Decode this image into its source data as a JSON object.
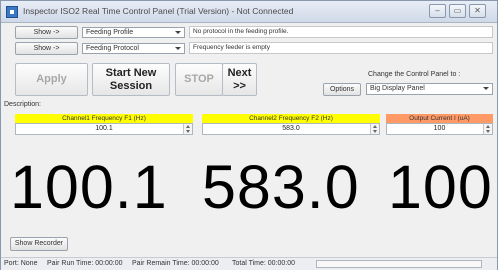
{
  "window": {
    "title": "Inspector ISO2 Real Time Control Panel (Trial Version)  -  Not Connected",
    "minimize": "–",
    "maximize": "▭",
    "close": "✕"
  },
  "profile_row": {
    "show_label": "Show ->",
    "combo_value": "Feeding Profile",
    "info_text": "No protocol in the feeding profile."
  },
  "protocol_row": {
    "show_label": "Show ->",
    "combo_value": "Feeding Protocol",
    "info_text": "Frequency feeder is empty"
  },
  "toolbar": {
    "apply_label": "Apply",
    "start_line1": "Start New",
    "start_line2": "Session",
    "stop_label": "STOP",
    "next_line1": "Next",
    "next_line2": ">>",
    "options_label": "Options",
    "change_panel_label": "Change the Control Panel to :",
    "panel_select": "Big Display Panel"
  },
  "description_label": "Description:",
  "channels": [
    {
      "title": "Channel1 Frequency F1 (Hz)",
      "input": "100.1",
      "display": "100.1",
      "color": "#ffff00"
    },
    {
      "title": "Channel2 Frequency F2 (Hz)",
      "input": "583.0",
      "display": "583.0",
      "color": "#ffff00"
    },
    {
      "title": "Output Current I (uA)",
      "input": "100",
      "display": "100",
      "color": "#ff9966"
    }
  ],
  "show_recorder_label": "Show Recorder",
  "status": {
    "port": "Port: None",
    "pair_run": "Pair Run Time: 00:00:00",
    "pair_remain": "Pair Remain Time: 00:00:00",
    "total": "Total Time: 00:00:00"
  }
}
